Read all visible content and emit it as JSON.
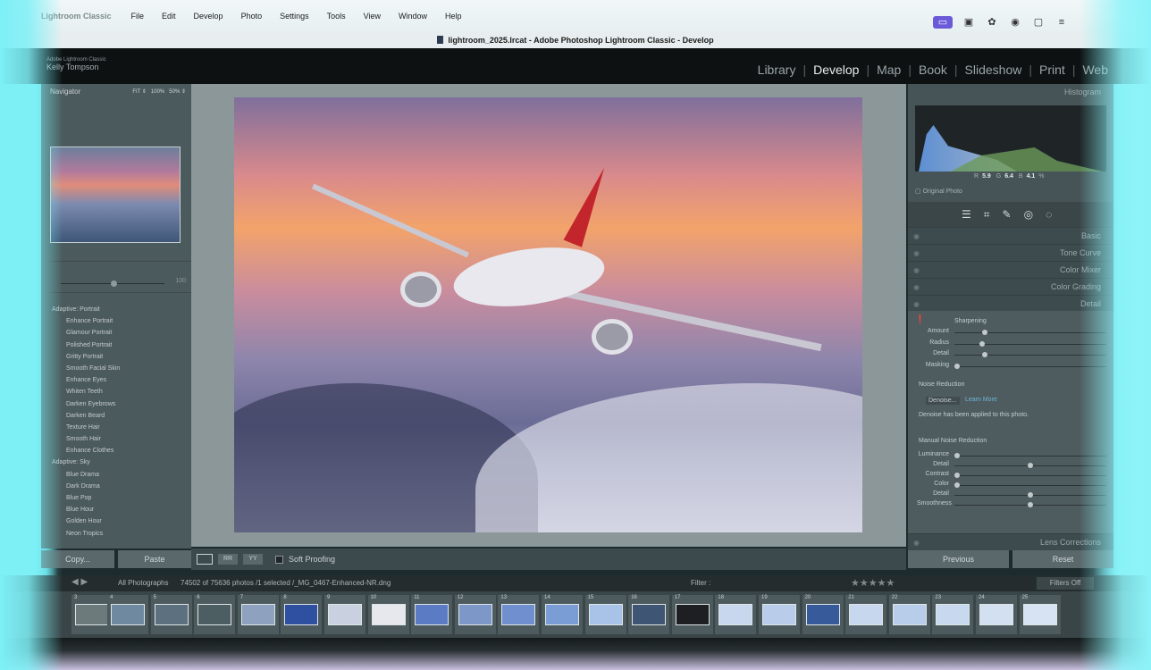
{
  "menubar": {
    "app": "Lightroom Classic",
    "items": [
      "File",
      "Edit",
      "Develop",
      "Photo",
      "Settings",
      "Tools",
      "View",
      "Window",
      "Help"
    ]
  },
  "window": {
    "title": "lightroom_2025.lrcat - Adobe Photoshop Lightroom Classic - Develop"
  },
  "identity": {
    "product": "Adobe Lightroom Classic",
    "user": "Kelly Tompson"
  },
  "modules": [
    "Library",
    "Develop",
    "Map",
    "Book",
    "Slideshow",
    "Print",
    "Web"
  ],
  "active_module": "Develop",
  "left_panel": {
    "navigator_title": "Navigator",
    "zoom_options": [
      "FIT",
      "100%",
      "50%"
    ],
    "slider_value": "100",
    "presets": [
      {
        "group": "Adaptive: Portrait",
        "items": [
          "Enhance Portrait",
          "Glamour Portrait",
          "Polished Portrait",
          "Gritty Portrait",
          "Smooth Facial Skin",
          "Enhance Eyes",
          "Whiten Teeth",
          "Darken Eyebrows",
          "Darken Beard",
          "Texture Hair",
          "Smooth Hair",
          "Enhance Clothes"
        ]
      },
      {
        "group": "Adaptive: Sky",
        "items": [
          "Blue Drama",
          "Dark Drama",
          "Blue Pop",
          "Blue Hour",
          "Golden Hour",
          "Neon Tropics"
        ]
      }
    ],
    "copy_label": "Copy...",
    "paste_label": "Paste"
  },
  "toolbar": {
    "soft_proofing": "Soft Proofing"
  },
  "right_panel": {
    "histogram_title": "Histogram",
    "rgb": {
      "r_label": "R",
      "r": "5.9",
      "g_label": "G",
      "g": "6.4",
      "b_label": "B",
      "b": "4.1",
      "unit": "%"
    },
    "original_photo": "Original Photo",
    "sections": [
      "Basic",
      "Tone Curve",
      "Color Mixer",
      "Color Grading",
      "Detail"
    ],
    "detail": {
      "sharpening": "Sharpening",
      "sliders": [
        {
          "label": "Amount",
          "value": 0.2
        },
        {
          "label": "Radius",
          "value": 0.18
        },
        {
          "label": "Detail",
          "value": 0.2
        },
        {
          "label": "Masking",
          "value": 0.02
        }
      ],
      "noise_reduction": "Noise Reduction",
      "denoise": "Denoise...",
      "learn_more": "Learn More",
      "denoise_note": "Denoise has been applied to this photo.",
      "manual_nr": "Manual Noise Reduction",
      "nr_sliders": [
        {
          "label": "Luminance",
          "value": 0.02
        },
        {
          "label": "Detail",
          "value": 0.5
        },
        {
          "label": "Contrast",
          "value": 0.02
        },
        {
          "label": "Color",
          "value": 0.02
        },
        {
          "label": "Detail",
          "value": 0.5
        },
        {
          "label": "Smoothness",
          "value": 0.5
        }
      ]
    },
    "lens_corrections": "Lens Corrections",
    "previous_label": "Previous",
    "reset_label": "Reset"
  },
  "filmstrip": {
    "source": "All Photographs",
    "count": "74502 of 75636 photos /1 selected /_MG_0467-Enhanced-NR.dng",
    "filter_label": "Filter :",
    "filters_off": "Filters Off",
    "cells": [
      "3",
      "4",
      "5",
      "6",
      "7",
      "8",
      "9",
      "10",
      "11",
      "12",
      "13",
      "14",
      "15",
      "16",
      "17",
      "18",
      "19",
      "20",
      "21",
      "22",
      "23",
      "24",
      "25"
    ]
  }
}
